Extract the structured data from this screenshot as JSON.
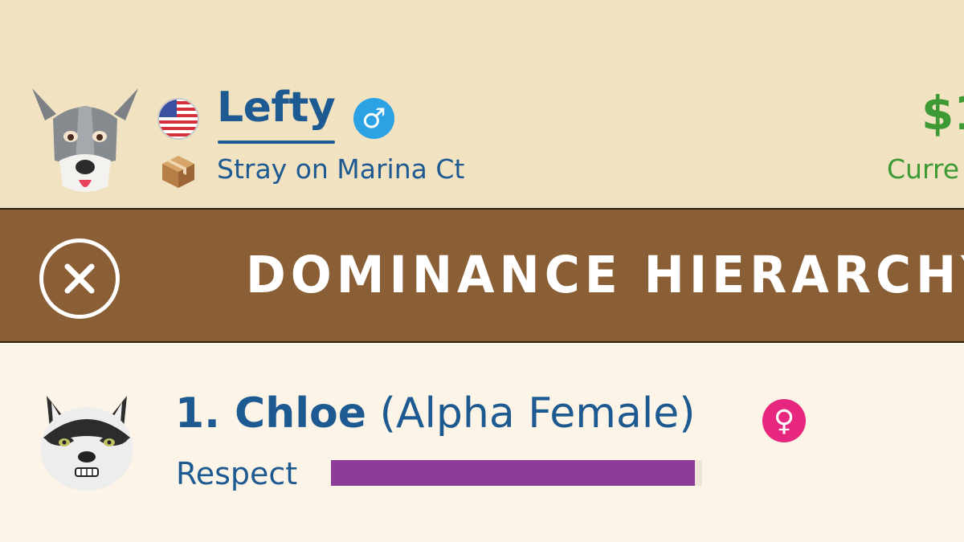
{
  "pet": {
    "name": "Lefty",
    "gender_symbol": "♂",
    "status": "Stray on Marina Ct"
  },
  "money": {
    "amount": "$1",
    "label": "Curre"
  },
  "hierarchy_bar": {
    "title": "DOMINANCE HIERARCHY"
  },
  "hierarchy": [
    {
      "rank_name": "1. Chloe",
      "title": "(Alpha Female)",
      "gender_symbol": "♀",
      "respect_label": "Respect",
      "respect_value": 0.98
    }
  ],
  "colors": {
    "header_bg": "#f1e2c1",
    "bar_bg": "#8a5f36",
    "list_bg": "#fcf4e6",
    "text_blue": "#1d5a91",
    "money_green": "#3d9a34",
    "male_blue": "#2aa2e3",
    "female_pink": "#e6267f",
    "respect_purple": "#8d3d98"
  },
  "icons": {
    "pet_avatar": "great-dane-face-icon",
    "country_flag": "us-flag-icon",
    "status_icon": "cardboard-box-icon",
    "close": "close-icon",
    "rival_avatar": "husky-face-icon"
  }
}
